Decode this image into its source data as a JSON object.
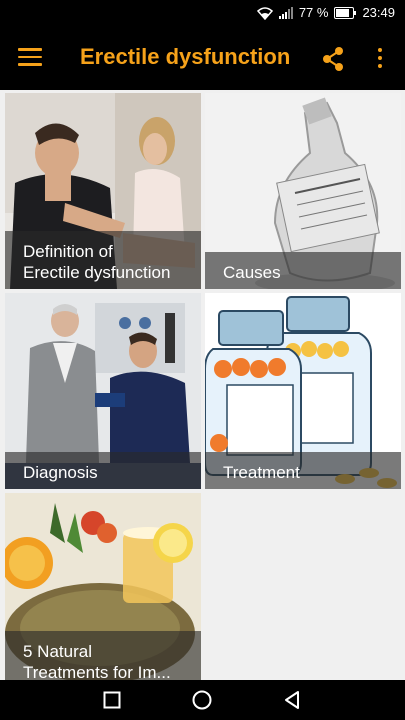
{
  "status_bar": {
    "battery_percent": "77 %",
    "time": "23:49"
  },
  "app_bar": {
    "title": "Erectile dysfunction",
    "menu_icon": "hamburger-menu-icon",
    "share_icon": "share-icon",
    "more_icon": "more-vertical-icon",
    "accent_color": "#f6a21a"
  },
  "tiles": [
    {
      "line1": "Definition of",
      "line2": "Erectile dysfunction"
    },
    {
      "line1": "Causes",
      "line2": ""
    },
    {
      "line1": "Diagnosis",
      "line2": ""
    },
    {
      "line1": "Treatment",
      "line2": ""
    },
    {
      "line1": "5 Natural",
      "line2": "Treatments for Im..."
    }
  ],
  "nav_bar": {
    "icons": [
      "recent-apps-icon",
      "home-icon",
      "back-icon"
    ]
  }
}
